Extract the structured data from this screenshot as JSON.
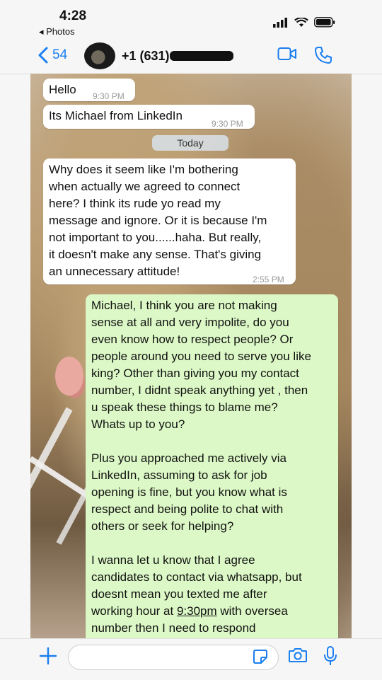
{
  "status_bar": {
    "time": "4:28",
    "back_app": "◂ Photos"
  },
  "header": {
    "back_count": "54",
    "contact_name": "+1 (631)"
  },
  "chat": {
    "date_divider": "Today",
    "messages": [
      {
        "direction": "in",
        "text": "Hello",
        "time": "9:30 PM"
      },
      {
        "direction": "in",
        "text": "Its Michael from LinkedIn",
        "time": "9:30 PM"
      },
      {
        "direction": "in",
        "text": "Why does it seem like I'm bothering\nwhen actually we agreed to connect\nhere? I think its rude yo read my\nmessage and ignore. Or it is because I'm\nnot important to you......haha. But really,\nit doesn't make any sense. That's giving\nan unnecessary attitude!",
        "time": "2:55 PM"
      },
      {
        "direction": "out",
        "text_part1": "Michael, I think you are not making\nsense at all and very impolite, do you\neven know how to respect people? Or\npeople around you need to serve you like\nking? Other than giving you my contact\nnumber, I didnt speak anything yet , then\nu speak these things to blame me?\nWhats up to you?\n\nPlus you approached me actively via\nLinkedIn, assuming to ask for job\nopening is fine, but you know what is\nrespect and being polite to chat with\nothers or seek for helping?\n\nI wanna let u know that I agree\ncandidates to contact via whatsapp, but\ndoesnt mean you texted me after\nworking hour at ",
        "text_link": "9:30pm",
        "text_part2": " with oversea\nnumber then I need to respond"
      }
    ]
  },
  "composer": {
    "placeholder": ""
  },
  "colors": {
    "accent": "#1a7ff0",
    "outgoing_bubble": "#dcf8c6",
    "incoming_bubble": "#ffffff"
  }
}
